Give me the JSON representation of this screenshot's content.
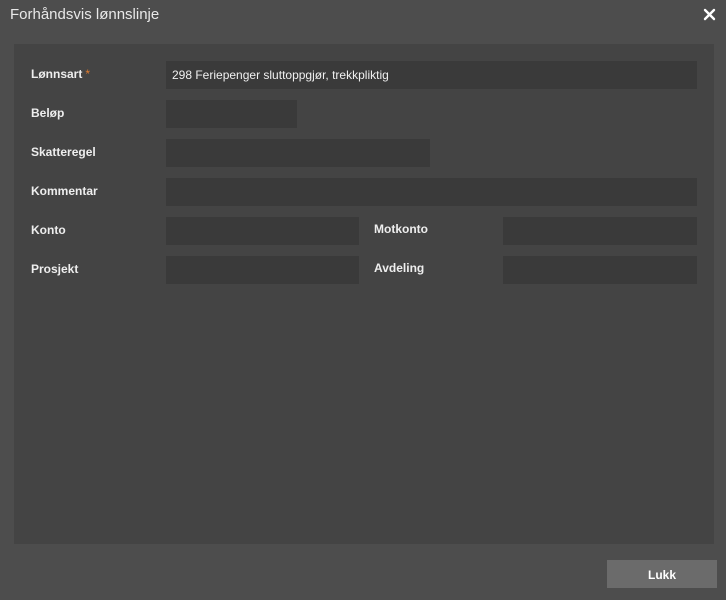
{
  "dialog": {
    "title": "Forhåndsvis lønnslinje",
    "close_icon": "close-icon"
  },
  "form": {
    "lonnsart": {
      "label": "Lønnsart",
      "required_mark": "*",
      "value": "298 Feriepenger sluttoppgjør, trekkpliktig"
    },
    "belop": {
      "label": "Beløp",
      "value": ""
    },
    "skatteregel": {
      "label": "Skatteregel",
      "value": ""
    },
    "kommentar": {
      "label": "Kommentar",
      "value": ""
    },
    "konto": {
      "label": "Konto",
      "value": ""
    },
    "motkonto": {
      "label": "Motkonto",
      "value": ""
    },
    "prosjekt": {
      "label": "Prosjekt",
      "value": ""
    },
    "avdeling": {
      "label": "Avdeling",
      "value": ""
    }
  },
  "footer": {
    "close_label": "Lukk"
  },
  "colors": {
    "background": "#4d4d4d",
    "panel": "#444444",
    "field": "#3a3a3a",
    "button": "#6b6b6b",
    "required": "#e07b2e"
  }
}
